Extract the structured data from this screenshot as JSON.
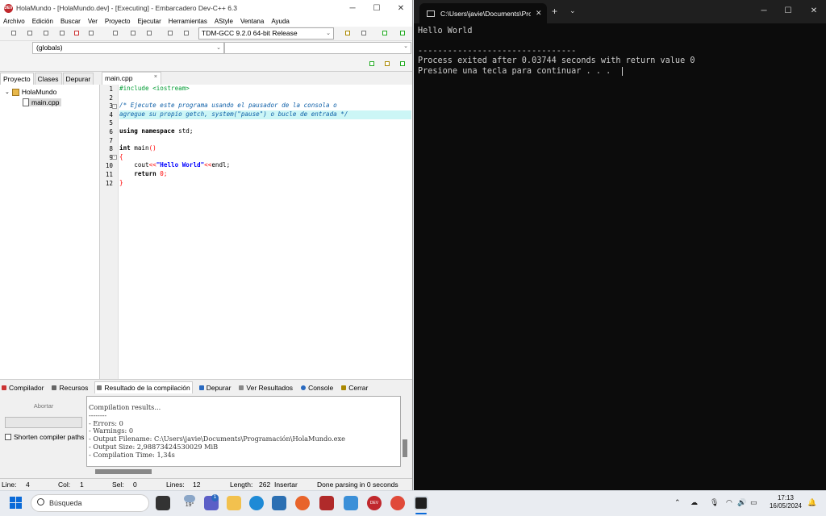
{
  "ide": {
    "title": "HolaMundo - [HolaMundo.dev] - [Executing] - Embarcadero Dev-C++ 6.3",
    "app_icon_text": "DEV",
    "menu": [
      "Archivo",
      "Edición",
      "Buscar",
      "Ver",
      "Proyecto",
      "Ejecutar",
      "Herramientas",
      "AStyle",
      "Ventana",
      "Ayuda"
    ],
    "compiler": "TDM-GCC 9.2.0 64-bit Release",
    "globals": "(globals)",
    "project_tabs": [
      "Proyecto",
      "Clases",
      "Depurar"
    ],
    "tree": {
      "project": "HolaMundo",
      "file": "main.cpp"
    },
    "editor_tab": "main.cpp",
    "tab_close": "×",
    "line_numbers": [
      "1",
      "2",
      "3",
      "4",
      "5",
      "6",
      "7",
      "8",
      "9",
      "10",
      "11",
      "12"
    ],
    "code": {
      "l1": "#include <iostream>",
      "l3": "/* Ejecute este programa usando el pausador de la consola o",
      "l4": "agregue su propio getch, system(\"pause\") o bucle de entrada */",
      "l6a": "using namespace",
      "l6b": " std;",
      "l8a": "int",
      "l8b": " main",
      "l8c": "()",
      "l9": "{",
      "l10a": "    cout",
      "l10b": "<<",
      "l10c": "\"Hello World\"",
      "l10d": "<<",
      "l10e": "endl;",
      "l11a": "    return",
      "l11b": " 0",
      "l11c": ";",
      "l12": "}"
    },
    "bottom_tabs": [
      "Compilador",
      "Recursos",
      "Resultado de la compilación",
      "Depurar",
      "Ver Resultados",
      "Console",
      "Cerrar"
    ],
    "abort_label": "Abortar",
    "shorten_label": "Shorten compiler paths",
    "log": [
      "Compilation results...",
      "--------",
      "- Errors: 0",
      "- Warnings: 0",
      "- Output Filename: C:\\Users\\javie\\Documents\\Programación\\HolaMundo.exe",
      "- Output Size: 2,98873424530029 MiB",
      "- Compilation Time: 1,34s"
    ],
    "status": {
      "line_label": "Line:",
      "line": "4",
      "col_label": "Col:",
      "col": "1",
      "sel_label": "Sel:",
      "sel": "0",
      "lines_label": "Lines:",
      "lines": "12",
      "length_label": "Length:",
      "length": "262",
      "mode": "Insertar",
      "message": "Done parsing in 0 seconds"
    }
  },
  "terminal": {
    "tab_title": "C:\\Users\\javie\\Documents\\Programación\\HolaMundo.exe",
    "output": [
      "Hello World",
      "",
      "--------------------------------",
      "Process exited after 0.03744 seconds with return value 0",
      "Presione una tecla para continuar . . . "
    ]
  },
  "taskbar": {
    "search_placeholder": "Búsqueda",
    "weather": "19°",
    "teams_badge": "1",
    "time": "17:13",
    "date": "16/05/2024",
    "icons": [
      "start-icon",
      "search-icon",
      "task-view-icon",
      "weather-icon",
      "teams-icon",
      "file-explorer-icon",
      "edge-icon",
      "store-icon",
      "firefox-icon",
      "devcpp-red-icon",
      "notepad-icon",
      "devcpp-icon",
      "chrome-icon",
      "terminal-icon"
    ],
    "colors": {
      "accent": "#0a6ad8"
    }
  },
  "colors": {
    "highlight_line": "#ccf6f6",
    "comment": "#0f60a8",
    "preprocessor": "#009c33",
    "string": "#0000ff",
    "number": "#ff0000",
    "terminal_bg": "#0c0c0c",
    "terminal_fg": "#cccccc"
  }
}
